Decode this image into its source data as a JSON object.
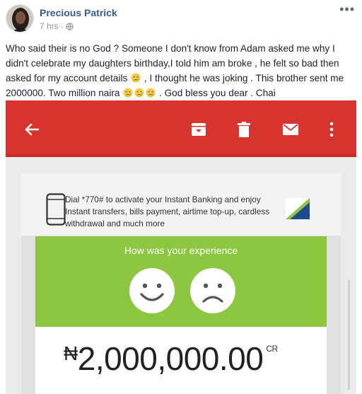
{
  "post": {
    "author": "Precious Patrick",
    "time": "7 hrs",
    "separator": "·",
    "more_label": "•••",
    "text_part1": "Who said their is no God ? Someone I don't know from Adam asked me why I didn't celebrate my daughters birthday,I told him am broke , he felt so bad then asked for my account details",
    "text_part2": ", I thought he was joking . This brother sent me 2000000. Two million naira",
    "text_part3": ". God bless you dear . Chai"
  },
  "screenshot": {
    "toolbar_icons": [
      "back-arrow-icon",
      "archive-icon",
      "trash-icon",
      "mail-icon",
      "more-vertical-icon"
    ],
    "promo_text": "Dial *770# to activate your Instant Banking and enjoy Instant transfers, bills payment, airtime top-up, cardless withdrawal and much more",
    "experience_title": "How was your experience",
    "currency_symbol": "₦",
    "amount": "2,000,000.00",
    "amount_suffix": "CR",
    "colors": {
      "toolbar": "#d8342f",
      "experience_panel": "#8dc641",
      "link": "#385898"
    }
  }
}
